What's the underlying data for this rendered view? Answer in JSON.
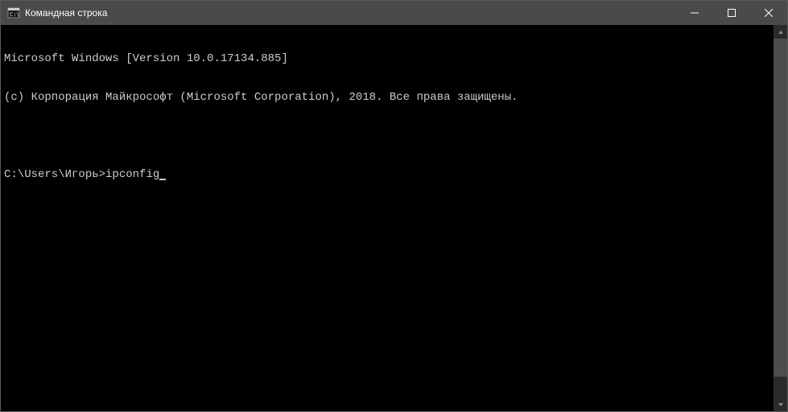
{
  "titlebar": {
    "title": "Командная строка"
  },
  "terminal": {
    "line1": "Microsoft Windows [Version 10.0.17134.885]",
    "line2": "(c) Корпорация Майкрософт (Microsoft Corporation), 2018. Все права защищены.",
    "prompt": "C:\\Users\\Игорь>",
    "command": "ipconfig"
  }
}
